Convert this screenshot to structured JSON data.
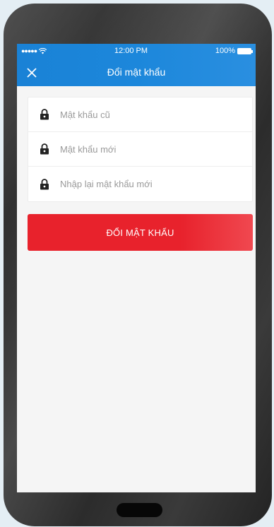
{
  "status_bar": {
    "signal": "●●●●●",
    "time": "12:00 PM",
    "battery": "100%"
  },
  "header": {
    "title": "Đổi mật khẩu",
    "close_icon": "close-icon"
  },
  "form": {
    "fields": [
      {
        "placeholder": "Mật khẩu cũ",
        "icon": "lock-icon"
      },
      {
        "placeholder": "Mật khẩu mới",
        "icon": "lock-icon"
      },
      {
        "placeholder": "Nhập lại mật khẩu mới",
        "icon": "lock-icon"
      }
    ],
    "submit_label": "ĐỔI MẬT KHẨU"
  },
  "colors": {
    "header": "#1c87db",
    "button": "#e8222c",
    "background": "#f5f5f5"
  }
}
